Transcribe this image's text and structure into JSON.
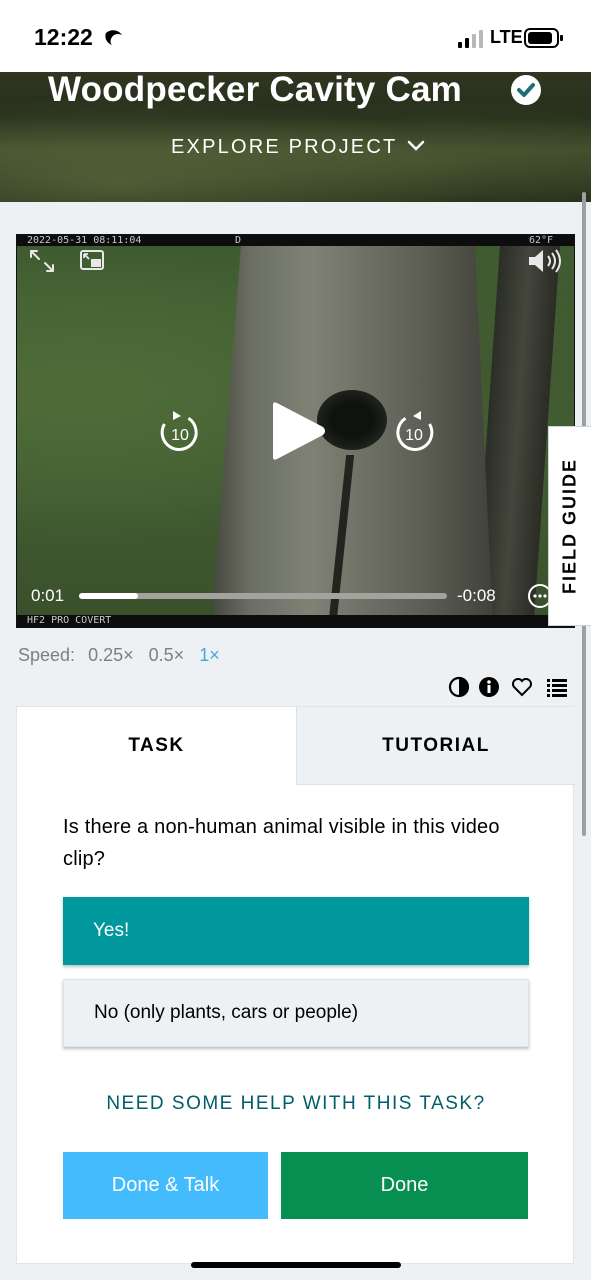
{
  "status_bar": {
    "time": "12:22",
    "network": "LTE"
  },
  "project": {
    "title": "Woodpecker Cavity Cam",
    "explore_label": "EXPLORE PROJECT",
    "icons": [
      "verified-check-icon",
      "chevron-down-icon"
    ]
  },
  "video": {
    "overlay_top_left": "2022-05-31 08:11:04",
    "overlay_top_mid": "D",
    "overlay_top_right": "62°F",
    "overlay_bottom": "HF2 PRO COVERT",
    "current_time": "0:01",
    "remaining_time": "-0:08",
    "progress": 0.16,
    "rewind_seconds": "10",
    "forward_seconds": "10",
    "icons": [
      "fullscreen-icon",
      "picture-in-picture-icon",
      "volume-icon",
      "rewind-10-icon",
      "play-icon",
      "forward-10-icon",
      "more-options-icon"
    ]
  },
  "field_guide": {
    "label": "FIELD GUIDE"
  },
  "speed": {
    "label": "Speed:",
    "options": [
      "0.25×",
      "0.5×",
      "1×"
    ],
    "selected": "1×"
  },
  "toolbar": {
    "icons": [
      "contrast-icon",
      "info-icon",
      "favorite-heart-icon",
      "collections-list-icon"
    ]
  },
  "task_panel": {
    "tabs": [
      "TASK",
      "TUTORIAL"
    ],
    "active_tab": "TASK",
    "question": "Is there a non-human animal visible in this video clip?",
    "answers": [
      "Yes!",
      "No (only plants, cars or people)"
    ],
    "help_link": "NEED SOME HELP WITH THIS TASK?",
    "done_talk_label": "Done & Talk",
    "done_label": "Done"
  },
  "colors": {
    "accent_teal": "#00979d",
    "done_green": "#078f52",
    "talk_blue": "#43bbfd",
    "help_text": "#005d69",
    "speed_active": "#42a9d8"
  }
}
